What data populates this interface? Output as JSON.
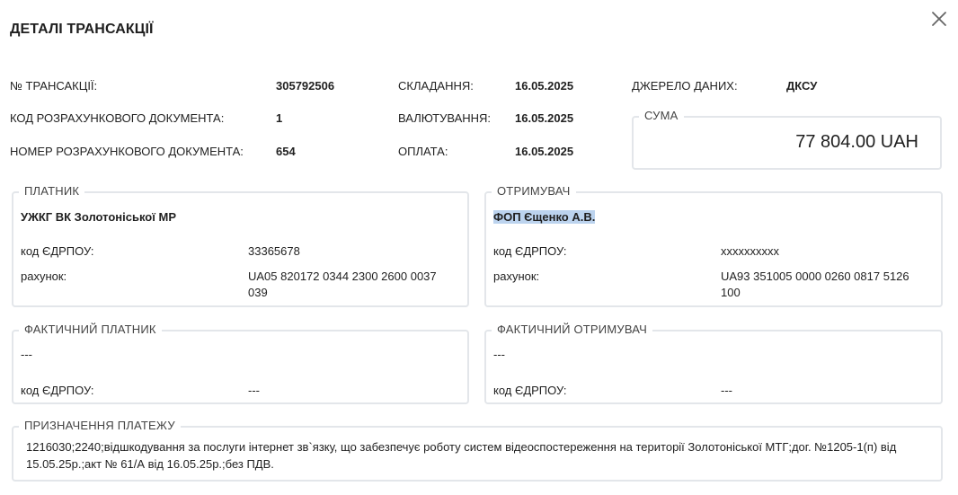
{
  "dialog": {
    "title": "ДЕТАЛІ ТРАНСАКЦІЇ",
    "close_icon": "close-icon"
  },
  "info": {
    "transaction_no_label": "№ ТРАНСАКЦІЇ:",
    "transaction_no_value": "305792506",
    "doc_code_label": "КОД РОЗРАХУНКОВОГО ДОКУМЕНТА:",
    "doc_code_value": "1",
    "doc_number_label": "НОМЕР РОЗРАХУНКОВОГО ДОКУМЕНТА:",
    "doc_number_value": "654",
    "compiled_label": "СКЛАДАННЯ:",
    "compiled_value": "16.05.2025",
    "valuation_label": "ВАЛЮТУВАННЯ:",
    "valuation_value": "16.05.2025",
    "payment_label": "ОПЛАТА:",
    "payment_value": "16.05.2025",
    "source_label": "ДЖЕРЕЛО ДАНИХ:",
    "source_value": "ДКСУ"
  },
  "sum": {
    "legend": "СУМА",
    "value": "77 804.00 UAH"
  },
  "payer": {
    "legend": "ПЛАТНИК",
    "name": "УЖКГ ВК Золотоніської МР",
    "edrpou_label": "код ЄДРПОУ:",
    "edrpou_value": "33365678",
    "account_label": "рахунок:",
    "account_value": "UA05 820172 0344 2300 2600 0037 039"
  },
  "receiver": {
    "legend": "ОТРИМУВАЧ",
    "name": "ФОП Єщенко А.В.",
    "edrpou_label": "код ЄДРПОУ:",
    "edrpou_value": "xxxxxxxxxx",
    "account_label": "рахунок:",
    "account_value": "UA93 351005 0000 0260 0817 5126 100"
  },
  "actual_payer": {
    "legend": "ФАКТИЧНИЙ ПЛАТНИК",
    "name": "---",
    "edrpou_label": "код ЄДРПОУ:",
    "edrpou_value": "---"
  },
  "actual_receiver": {
    "legend": "ФАКТИЧНИЙ ОТРИМУВАЧ",
    "name": "---",
    "edrpou_label": "код ЄДРПОУ:",
    "edrpou_value": "---"
  },
  "purpose": {
    "legend": "ПРИЗНАЧЕННЯ ПЛАТЕЖУ",
    "text": "1216030;2240;відшкодування за послуги інтернет зв`язку, що забезпечує роботу систем відеоспостереження на території Золотоніської МТГ;дог. №1205-1(п) від 15.05.25р.;акт № 61/А від 16.05.25р.;без ПДВ."
  },
  "colors": {
    "border": "#e3e6ea",
    "highlight": "#bcd3ee",
    "text": "#222222"
  }
}
